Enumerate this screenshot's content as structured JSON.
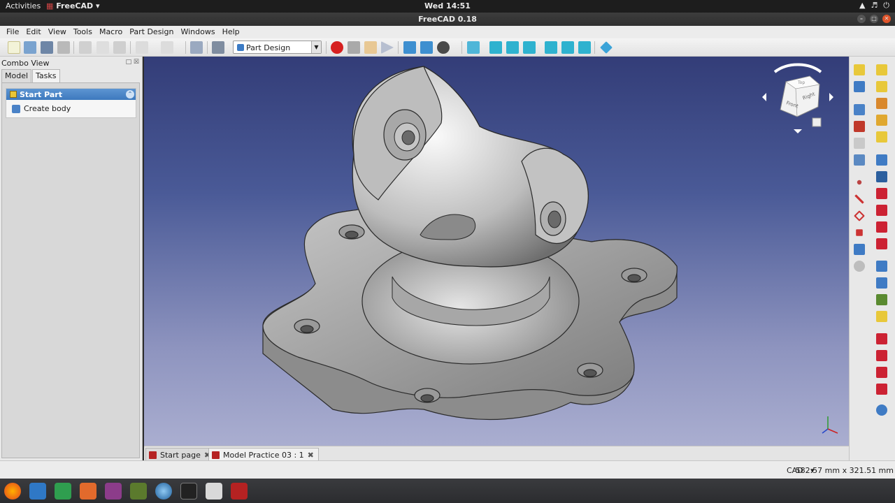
{
  "topbar": {
    "activities": "Activities",
    "app_name": "FreeCAD",
    "clock": "Wed 14:51"
  },
  "window": {
    "title": "FreeCAD 0.18"
  },
  "menu": [
    "File",
    "Edit",
    "View",
    "Tools",
    "Macro",
    "Part Design",
    "Windows",
    "Help"
  ],
  "toolbar": {
    "workbench": "Part Design"
  },
  "combo_view": {
    "title": "Combo View",
    "tabs": [
      "Model",
      "Tasks"
    ],
    "task_header": "Start Part",
    "task_item": "Create body"
  },
  "navcube": {
    "labels": [
      "Front",
      "Right",
      "Top"
    ]
  },
  "document_tabs": [
    "Start page",
    "Model Practice 03 : 1"
  ],
  "status": {
    "nav_style": "CAD",
    "dimensions": "582.57 mm x 321.51 mm"
  },
  "colors": {
    "accent": "#3d79be",
    "viewport_top": "#333d78",
    "viewport_bottom": "#aaaed0",
    "freecad_red": "#b52222"
  },
  "icons": [
    "wifi-icon",
    "volume-icon",
    "power-icon",
    "new-file-icon",
    "open-file-icon",
    "save-icon",
    "record-macro-icon",
    "stop-macro-icon",
    "fit-all-icon",
    "isometric-view-icon",
    "measure-icon"
  ]
}
